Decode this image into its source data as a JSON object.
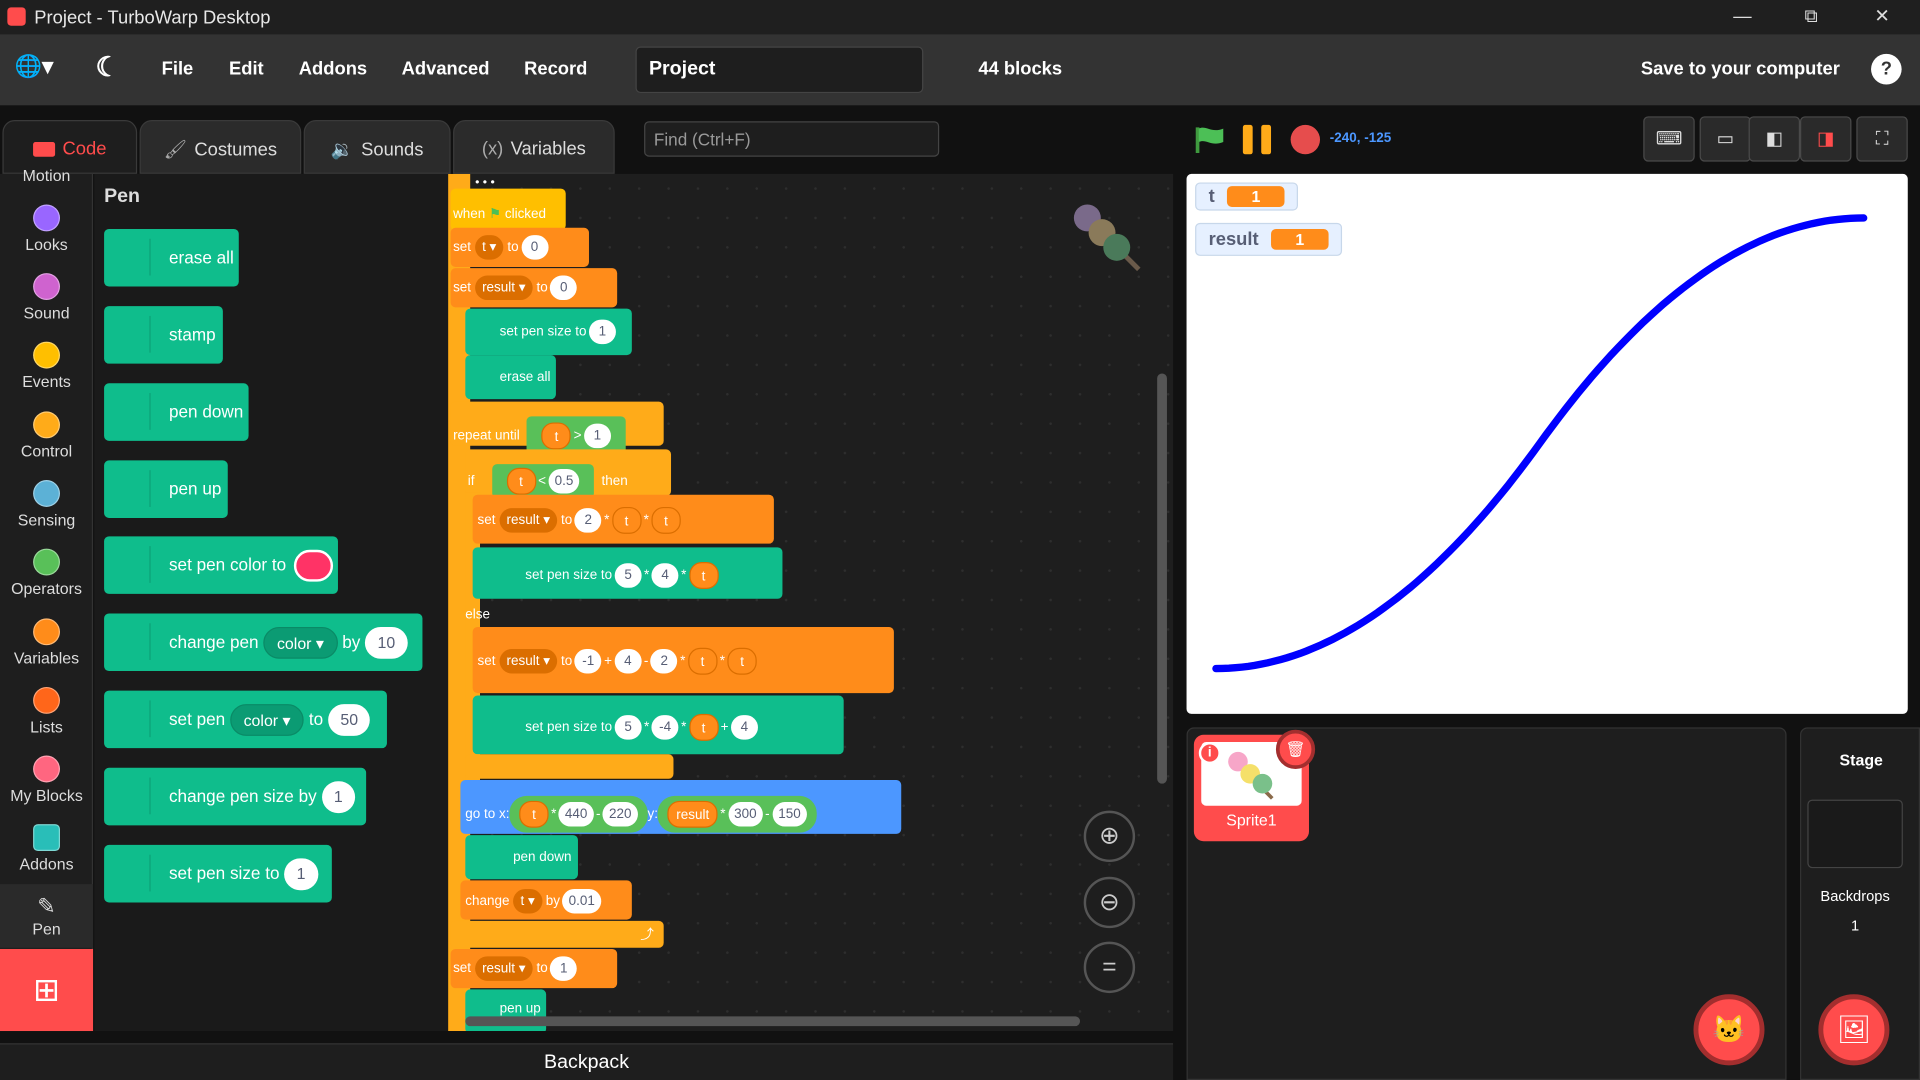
{
  "window": {
    "title": "Project - TurboWarp Desktop",
    "minimize": "—",
    "maximize": "⧉",
    "close": "✕"
  },
  "menu": {
    "globe": "🌐▾",
    "theme": "☾",
    "file": "File",
    "edit": "Edit",
    "addons": "Addons",
    "advanced": "Advanced",
    "record": "Record",
    "project_title": "Project",
    "block_count": "44 blocks",
    "save": "Save to your computer",
    "help": "?"
  },
  "tabs": {
    "code": "Code",
    "costumes": "Costumes",
    "sounds": "Sounds",
    "variables": "Variables"
  },
  "find": {
    "placeholder": "Find (Ctrl+F)"
  },
  "stage_controls": {
    "coords": "-240, -125"
  },
  "view_buttons": [
    "⌨",
    "▭",
    "◧",
    "◨",
    "⛶"
  ],
  "categories": [
    {
      "label": "Motion",
      "color": "#4c97ff"
    },
    {
      "label": "Looks",
      "color": "#9966ff"
    },
    {
      "label": "Sound",
      "color": "#cf63cf"
    },
    {
      "label": "Events",
      "color": "#ffbf00"
    },
    {
      "label": "Control",
      "color": "#ffab19"
    },
    {
      "label": "Sensing",
      "color": "#5cb1d6"
    },
    {
      "label": "Operators",
      "color": "#59c059"
    },
    {
      "label": "Variables",
      "color": "#ff8c1a"
    },
    {
      "label": "Lists",
      "color": "#ff661a"
    },
    {
      "label": "My Blocks",
      "color": "#ff6680"
    },
    {
      "label": "Addons",
      "color": "#29beb8"
    },
    {
      "label": "Pen",
      "color": "#0fbd8c"
    }
  ],
  "flyout": {
    "heading": "Pen",
    "erase_all": "erase all",
    "stamp": "stamp",
    "pen_down": "pen down",
    "pen_up": "pen up",
    "set_pen_color_to": "set pen color to",
    "change_pen": "change pen",
    "color_dd": "color ▾",
    "by": "by",
    "change_val": "10",
    "set_pen": "set pen",
    "to": "to",
    "set_val": "50",
    "change_pen_size_by": "change pen size by",
    "size_change_val": "1",
    "set_pen_size_to": "set pen size to",
    "size_set_val": "1"
  },
  "script": {
    "when_clicked": "when",
    "clicked": "clicked",
    "set": "set",
    "to": "to",
    "t_dd": "t ▾",
    "result_dd": "result ▾",
    "zero": "0",
    "set_pen_size_to": "set pen size to",
    "one": "1",
    "erase_all": "erase all",
    "repeat_until": "repeat until",
    "t": "t",
    "gt": ">",
    "lt": "<",
    "half": "0.5",
    "if": "if",
    "then": "then",
    "two": "2",
    "times": "*",
    "five": "5",
    "four": "4",
    "else": "else",
    "neg_one": "-1",
    "plus": "+",
    "minus": "-",
    "neg_four": "-4",
    "go_to_x": "go to x:",
    "y": "y:",
    "n440": "440",
    "n220": "220",
    "result": "result",
    "n300": "300",
    "n150": "150",
    "pen_down": "pen down",
    "change": "change",
    "by": "by",
    "step": "0.01",
    "loop_arrow": "⤴",
    "pen_up": "pen up",
    "dots": "• • •"
  },
  "zoom": {
    "in": "⊕",
    "out": "⊖",
    "reset": "="
  },
  "monitors": [
    {
      "name": "t",
      "value": "1"
    },
    {
      "name": "result",
      "value": "1"
    }
  ],
  "sprites": {
    "sprite1": "Sprite1",
    "info": "i",
    "delete": "🗑"
  },
  "stage_pane": {
    "title": "Stage",
    "backdrops_label": "Backdrops",
    "backdrops_count": "1"
  },
  "backpack": "Backpack",
  "colors": {
    "accent": "#ff4c4c",
    "pen": "#0fbd8c",
    "variables": "#ff8c1a",
    "control": "#ffab19",
    "events": "#ffbf00",
    "motion": "#4c97ff",
    "operators": "#59c059",
    "curve": "#0000ff"
  }
}
